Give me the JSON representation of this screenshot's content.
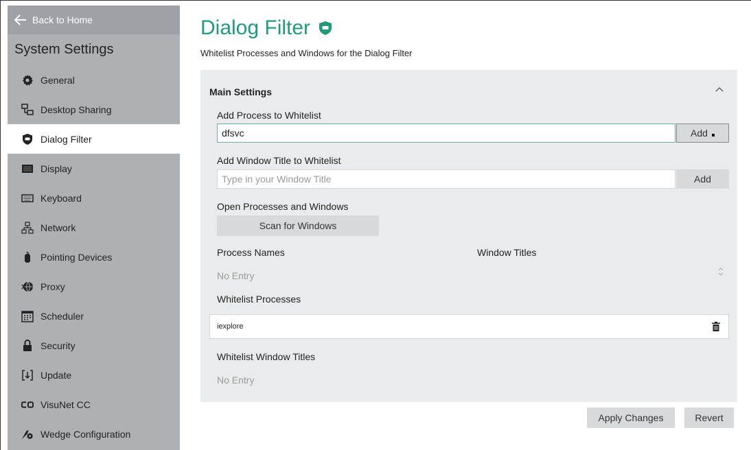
{
  "sidebar": {
    "back_label": "Back to Home",
    "title": "System Settings",
    "items": [
      {
        "label": "General",
        "icon": "gear-icon"
      },
      {
        "label": "Desktop Sharing",
        "icon": "desktop-sharing-icon"
      },
      {
        "label": "Dialog Filter",
        "icon": "shield-icon",
        "active": true
      },
      {
        "label": "Display",
        "icon": "display-icon"
      },
      {
        "label": "Keyboard",
        "icon": "keyboard-icon"
      },
      {
        "label": "Network",
        "icon": "network-icon"
      },
      {
        "label": "Pointing Devices",
        "icon": "mouse-icon"
      },
      {
        "label": "Proxy",
        "icon": "proxy-icon"
      },
      {
        "label": "Scheduler",
        "icon": "calendar-icon"
      },
      {
        "label": "Security",
        "icon": "lock-icon"
      },
      {
        "label": "Update",
        "icon": "update-icon"
      },
      {
        "label": "VisuNet CC",
        "icon": "visunet-icon"
      },
      {
        "label": "Wedge Configuration",
        "icon": "wedge-icon"
      }
    ]
  },
  "header": {
    "title": "Dialog Filter",
    "subtitle": "Whitelist Processes and Windows for the Dialog Filter",
    "accent_color": "#1f9b79"
  },
  "main_settings": {
    "section_title": "Main Settings",
    "add_process_label": "Add Process to Whitelist",
    "add_process_value": "dfsvc",
    "add_button_label": "Add",
    "add_window_label": "Add Window Title to Whitelist",
    "add_window_placeholder": "Type in your Window Title",
    "open_processes_label": "Open Processes and Windows",
    "scan_button_label": "Scan for Windows",
    "process_names_header": "Process Names",
    "window_titles_header": "Window Titles",
    "no_entry": "No Entry",
    "whitelist_processes_label": "Whitelist Processes",
    "whitelist_processes": [
      "iexplore"
    ],
    "whitelist_windows_label": "Whitelist Window Titles"
  },
  "footer": {
    "apply_label": "Apply Changes",
    "revert_label": "Revert"
  }
}
